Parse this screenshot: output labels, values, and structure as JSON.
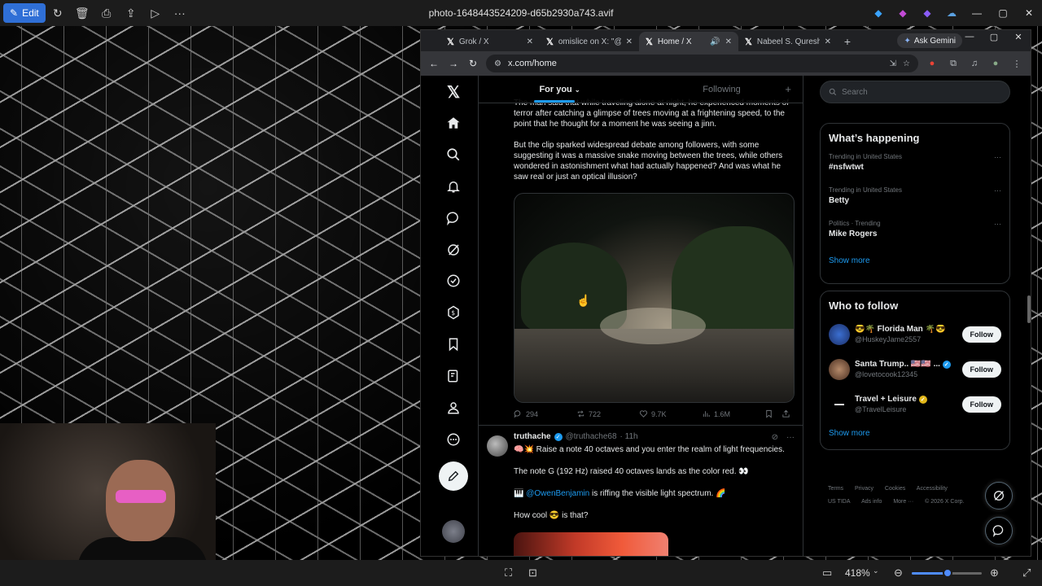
{
  "viewer": {
    "title": "photo-1648443524209-d65b2930a743.avif",
    "edit_label": "Edit",
    "zoom_label": "418%",
    "zoom_fraction": 0.51
  },
  "browser": {
    "tabs": [
      {
        "label": "Grok / X"
      },
      {
        "label": "omislice on X: \"@Kot"
      },
      {
        "label": "Home / X"
      },
      {
        "label": "Nabeel S. Qureshi on"
      }
    ],
    "gemini_label": "Ask Gemini",
    "url": "x.com/home",
    "ext_badge": "2"
  },
  "x": {
    "tabs": {
      "for_you": "For you",
      "following": "Following"
    },
    "tweet1": {
      "lead": "The man said that while traveling alone at night, he experienced moments of terror after catching a glimpse of trees moving at a frightening speed, to the point that he thought for a moment he was seeing a jinn.",
      "body": "But the clip sparked widespread debate among followers, with some suggesting it was a massive snake moving between the trees, while others wondered in astonishment what had actually happened? And was what he saw real or just an optical illusion?",
      "replies": "294",
      "reposts": "722",
      "likes": "9.7K",
      "views": "1.6M"
    },
    "tweet2": {
      "name": "truthache",
      "handle": "@truthache68",
      "time": "· 11h",
      "line1": "🧠💥 Raise a note 40 octaves and you enter the realm of light frequencies.",
      "line2": "The note G (192 Hz) raised 40 octaves lands as the color red. 👀",
      "mention": "@OwenBenjamin",
      "line3_rest": " is riffing the visible light spectrum. 🌈",
      "line4": "How cool 😎 is that?"
    },
    "search_placeholder": "Search",
    "trending": {
      "title": "What’s happening",
      "items": [
        {
          "meta": "Trending in United States",
          "topic": "#nsfwtwt"
        },
        {
          "meta": "Trending in United States",
          "topic": "Betty"
        },
        {
          "meta": "Politics · Trending",
          "topic": "Mike Rogers"
        }
      ],
      "show_more": "Show more"
    },
    "who_to_follow": {
      "title": "Who to follow",
      "items": [
        {
          "name": "😎🌴 Florida Man 🌴😎",
          "handle": "@HuskeyJame2557",
          "follow": "Follow"
        },
        {
          "name": "Santa Trump.. 🇺🇸🇺🇸 ...",
          "handle": "@lovetocook12345",
          "follow": "Follow"
        },
        {
          "name": "Travel + Leisure",
          "handle": "@TravelLeisure",
          "follow": "Follow"
        }
      ],
      "show_more": "Show more"
    },
    "footer": {
      "line1": [
        "Terms",
        "Privacy",
        "Cookies",
        "Accessibility"
      ],
      "line2": [
        "US TIDA",
        "Ads info",
        "More ···",
        "© 2026 X Corp."
      ]
    }
  }
}
